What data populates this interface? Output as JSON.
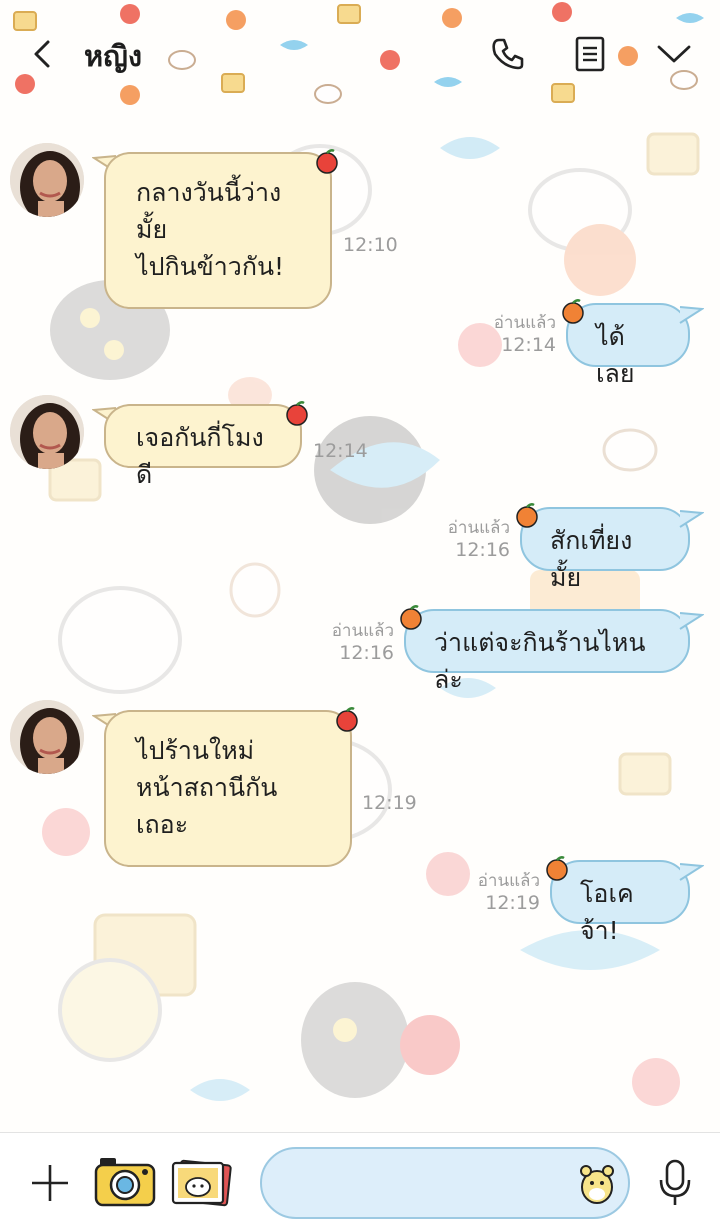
{
  "header": {
    "back_icon": "chevron-left-icon",
    "title": "หญิง",
    "call_icon": "phone-icon",
    "notes_icon": "notes-icon",
    "menu_icon": "chevron-down-icon"
  },
  "messages": [
    {
      "direction": "in",
      "lines": [
        "กลางวันนี้ว่างมั้ย",
        "ไปกินข้าวกัน!"
      ],
      "time": "12:10"
    },
    {
      "direction": "out",
      "text": "ได้เลย",
      "read": "อ่านแล้ว",
      "time": "12:14"
    },
    {
      "direction": "in",
      "lines": [
        "เจอกันกี่โมงดี"
      ],
      "time": "12:14"
    },
    {
      "direction": "out",
      "text": "สักเที่ยงมั้ย",
      "read": "อ่านแล้ว",
      "time": "12:16"
    },
    {
      "direction": "out",
      "text": "ว่าแต่จะกินร้านไหนล่ะ",
      "read": "อ่านแล้ว",
      "time": "12:16"
    },
    {
      "direction": "in",
      "lines": [
        "ไปร้านใหม่",
        "หน้าสถานีกันเถอะ"
      ],
      "time": "12:19"
    },
    {
      "direction": "out",
      "text": "โอเคจ้า!",
      "read": "อ่านแล้ว",
      "time": "12:19"
    }
  ],
  "bottom_bar": {
    "plus_icon": "plus-icon",
    "camera_icon": "camera-icon",
    "gallery_icon": "photo-gallery-icon",
    "input_placeholder": "",
    "emoji_icon": "hamster-sticker-icon",
    "mic_icon": "microphone-icon"
  },
  "colors": {
    "incoming_bubble": "#fdf3cf",
    "incoming_border": "#c9b48b",
    "outgoing_bubble": "#d5ecf8",
    "outgoing_border": "#8fc5df",
    "meta_text": "#9c9c9c"
  }
}
